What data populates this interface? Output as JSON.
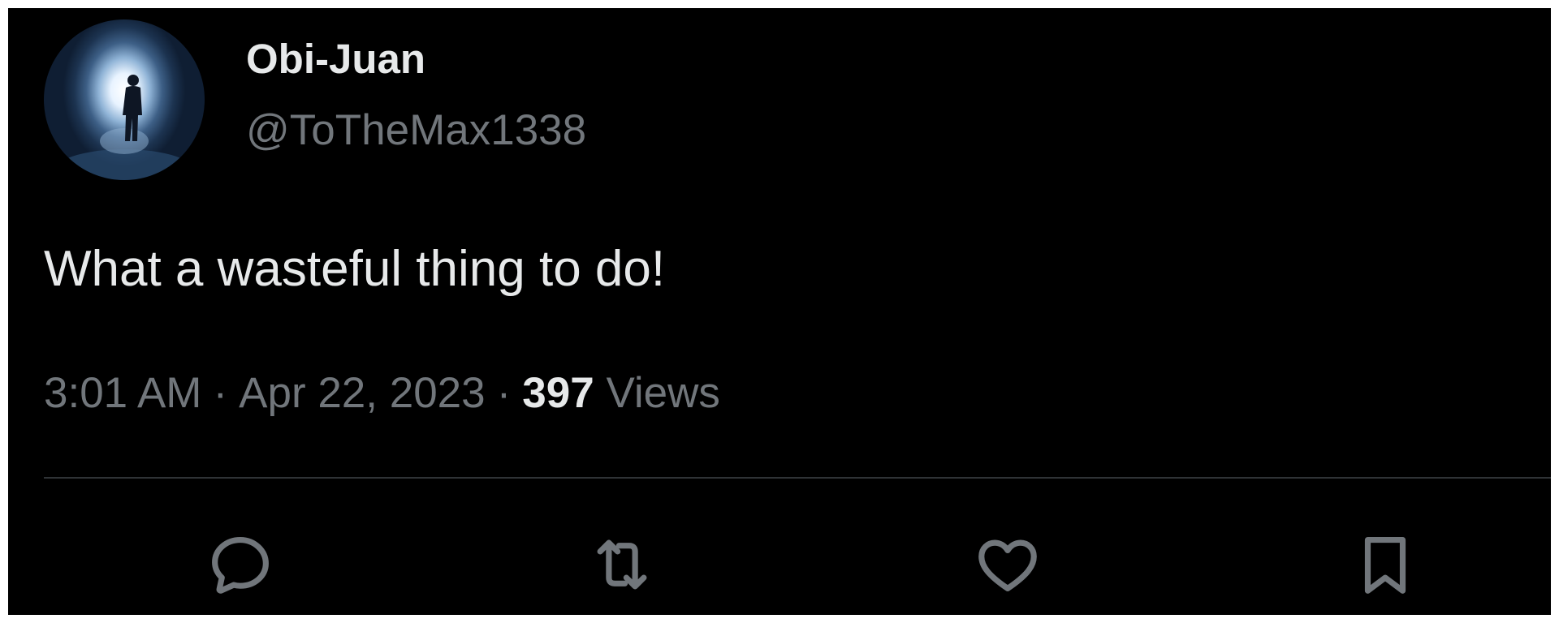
{
  "tweet": {
    "author": {
      "display_name": "Obi-Juan",
      "handle": "@ToTheMax1338",
      "avatar_icon": "cave-silhouette-avatar"
    },
    "text": "What a wasteful thing to do!",
    "meta": {
      "time": "3:01 AM",
      "separator": "·",
      "date": "Apr 22, 2023",
      "views_count": "397",
      "views_label": "Views"
    },
    "actions": [
      {
        "name": "reply",
        "icon": "speech-bubble-icon"
      },
      {
        "name": "retweet",
        "icon": "retweet-arrows-icon"
      },
      {
        "name": "like",
        "icon": "heart-icon"
      },
      {
        "name": "bookmark",
        "icon": "bookmark-icon"
      }
    ]
  },
  "colors": {
    "background": "#000000",
    "primary_text": "#e7e9ea",
    "secondary_text": "#71767b",
    "divider": "#2f3336",
    "icon": "#71767b"
  }
}
